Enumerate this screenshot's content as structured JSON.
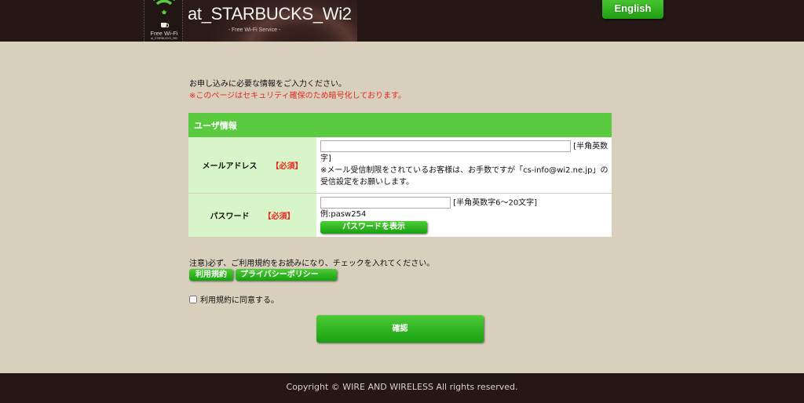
{
  "header": {
    "brand_title": "at_STARBUCKS_Wi2",
    "brand_subtitle": "- Free Wi-Fi Service -",
    "wifi_label": "Free Wi-Fi",
    "wifi_sublabel": "at_STARBUCKS_Wi2",
    "english_button": "English"
  },
  "intro": {
    "line1": "お申し込みに必要な情報をご入力ください。",
    "line2": "※このページはセキュリティ確保のため暗号化しております。"
  },
  "form": {
    "section_title": "ユーザ情報",
    "email": {
      "label": "メールアドレス",
      "required": "【必須】",
      "value": "",
      "hint": "[半角英数字]",
      "note": "※メール受信制限をされているお客様は、お手数ですが「cs-info@wi2.ne.jp」の受信設定をお願いします。"
    },
    "password": {
      "label": "パスワード",
      "required": "【必須】",
      "value": "",
      "hint": "[半角英数字6〜20文字]",
      "example": "例:pasw254",
      "show_button": "パスワードを表示"
    }
  },
  "notice": {
    "text": "注意)必ず、ご利用規約をお読みになり、チェックを入れてください。",
    "terms_button": "利用規約",
    "privacy_button": "プライバシーポリシー",
    "agree_label": "利用規約に同意する。",
    "agree_checked": false
  },
  "confirm_button": "確認",
  "footer": {
    "copyright": "Copyright © WIRE AND WIRELESS All rights reserved."
  },
  "colors": {
    "accent_green": "#5acb40",
    "button_green": "#1fa014",
    "label_bg": "#d7f5c8",
    "required_red": "#e8281e",
    "header_bg": "#241716",
    "page_bg": "#d8d0bd"
  }
}
